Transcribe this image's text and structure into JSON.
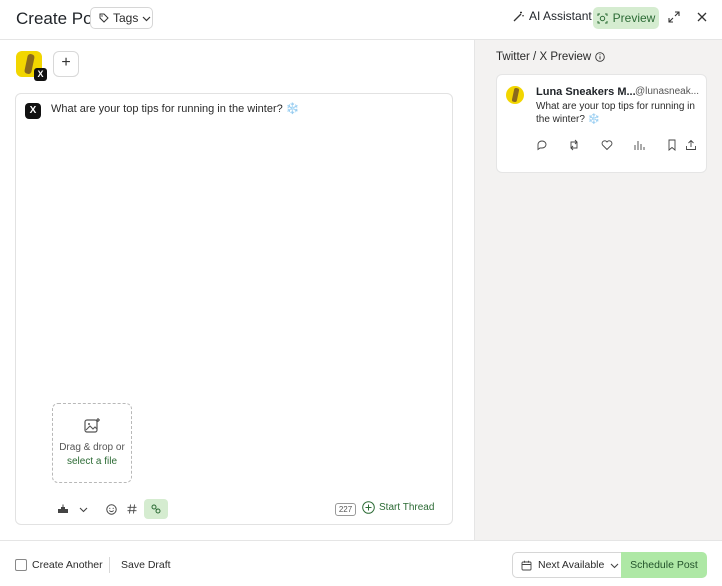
{
  "header": {
    "title": "Create Post",
    "tags_label": "Tags",
    "ai_label": "AI Assistant",
    "preview_label": "Preview"
  },
  "composer": {
    "text": "What are your top tips for running in the winter? ❄️",
    "dropzone_line1": "Drag & drop or",
    "dropzone_line2": "select a file",
    "char_count": "227",
    "thread_label": "Start Thread",
    "add_account": "+"
  },
  "preview": {
    "title": "Twitter / X Preview",
    "name": "Luna Sneakers M...",
    "handle": "@lunasneak...",
    "text": "What are your top tips for running in the winter? ❄️"
  },
  "footer": {
    "create_another": "Create Another",
    "save_draft": "Save Draft",
    "next_available": "Next Available",
    "schedule": "Schedule Post"
  },
  "colors": {
    "accent_green": "#aee8a5",
    "preview_bg": "#d5ecd0",
    "link_green": "#2c6b35"
  }
}
